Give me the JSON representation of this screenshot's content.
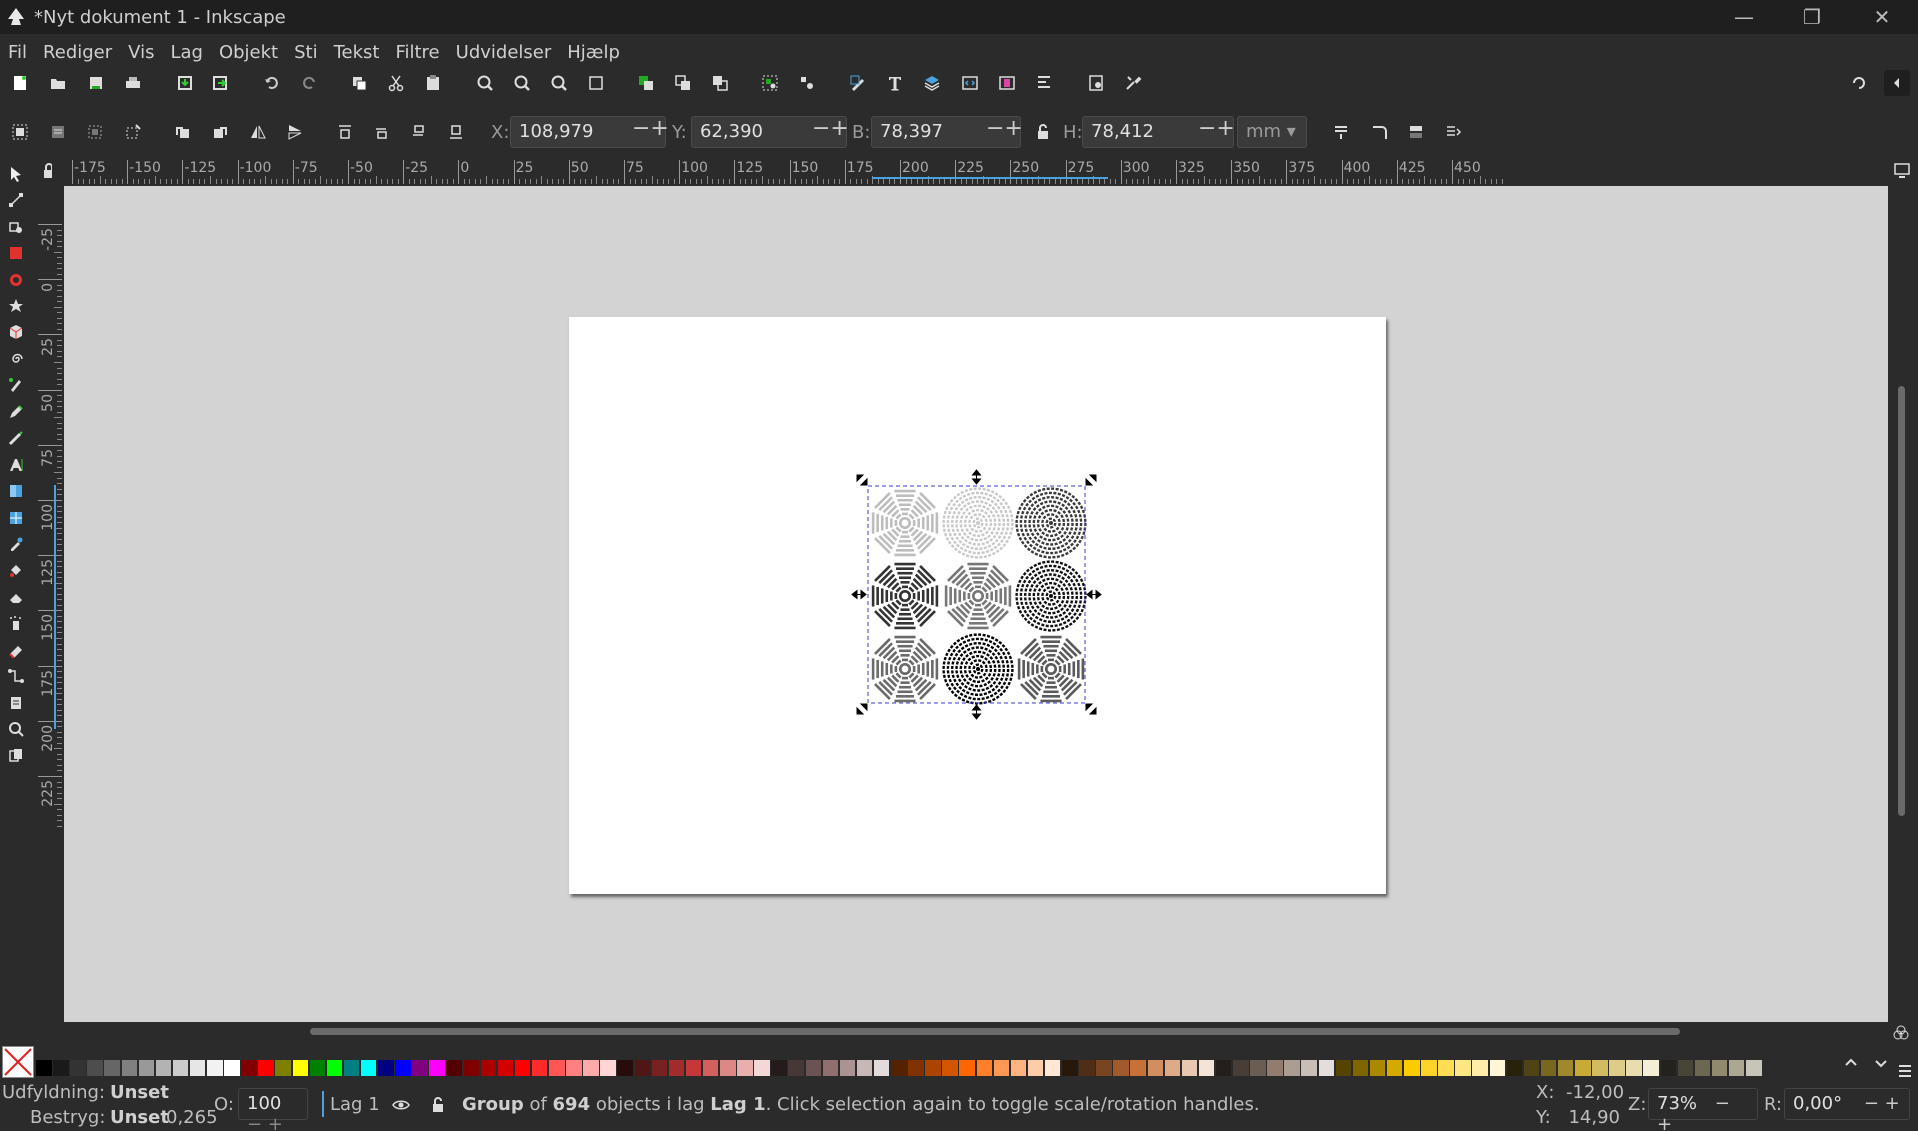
{
  "window": {
    "title": "*Nyt dokument 1 - Inkscape"
  },
  "menu": [
    "Fil",
    "Rediger",
    "Vis",
    "Lag",
    "Objekt",
    "Sti",
    "Tekst",
    "Filtre",
    "Udvidelser",
    "Hjælp"
  ],
  "toolbar_icons": [
    "new-document-icon",
    "open-icon",
    "save-icon",
    "print-icon",
    "import-icon",
    "export-icon",
    "undo-icon",
    "redo-icon",
    "copy-icon",
    "cut-icon",
    "paste-icon",
    "zoom-selection-icon",
    "zoom-drawing-icon",
    "zoom-page-icon",
    "zoom-width-icon",
    "duplicate-icon",
    "clone-icon",
    "unlink-clone-icon",
    "group-icon",
    "ungroup-icon",
    "fill-stroke-icon",
    "text-font-icon",
    "layers-icon",
    "xml-editor-icon",
    "objects-icon",
    "align-icon",
    "document-properties-icon",
    "preferences-icon"
  ],
  "controls": {
    "x_label": "X:",
    "x_value": "108,979",
    "y_label": "Y:",
    "y_value": "62,390",
    "w_label": "B:",
    "w_value": "78,397",
    "h_label": "H:",
    "h_value": "78,412",
    "unit": "mm"
  },
  "rulers": {
    "h_ticks": [
      "-175",
      "-150",
      "-125",
      "-100",
      "-75",
      "-50",
      "-25",
      "0",
      "25",
      "50",
      "75",
      "100",
      "125",
      "150",
      "175",
      "200",
      "225",
      "250",
      "275",
      "300",
      "325",
      "350",
      "375",
      "400",
      "425",
      "450"
    ],
    "v_ticks": [
      "-25",
      "0",
      "25",
      "50",
      "75",
      "100",
      "125",
      "150",
      "175",
      "200",
      "225"
    ]
  },
  "tools": [
    "selector-tool-icon",
    "node-tool-icon",
    "tweak-tool-icon",
    "rectangle-tool-icon",
    "ellipse-tool-icon",
    "star-tool-icon",
    "box3d-tool-icon",
    "spiral-tool-icon",
    "pen-tool-icon",
    "pencil-tool-icon",
    "calligraphy-tool-icon",
    "text-tool-icon",
    "gradient-tool-icon",
    "mesh-tool-icon",
    "dropper-tool-icon",
    "paint-bucket-tool-icon",
    "eraser-tool-icon",
    "spray-tool-icon",
    "measure-eraser-icon",
    "connector-tool-icon",
    "pages-tool-icon",
    "zoom-tool-icon",
    "pages-2-icon"
  ],
  "colors": {
    "accent": "#4aa3df",
    "selection": "#3a3ad0"
  },
  "palette": [
    "#000000",
    "#1a1a1a",
    "#333333",
    "#4d4d4d",
    "#666666",
    "#808080",
    "#999999",
    "#b3b3b3",
    "#cccccc",
    "#e6e6e6",
    "#f2f2f2",
    "#ffffff",
    "#800000",
    "#ff0000",
    "#808000",
    "#ffff00",
    "#008000",
    "#00ff00",
    "#008080",
    "#00ffff",
    "#000080",
    "#0000ff",
    "#800080",
    "#ff00ff",
    "#550000",
    "#800000",
    "#aa0000",
    "#d40000",
    "#ff0000",
    "#ff2a2a",
    "#ff5555",
    "#ff8080",
    "#ffaaaa",
    "#ffd5d5",
    "#280b0b",
    "#501616",
    "#782121",
    "#a02c2c",
    "#c83737",
    "#d35f5f",
    "#de8787",
    "#e9afaf",
    "#f4d7d7",
    "#241c1c",
    "#483737",
    "#6c5353",
    "#916f6f",
    "#ac9393",
    "#c8b7b7",
    "#e3dbdb",
    "#552200",
    "#803300",
    "#aa4400",
    "#d45500",
    "#ff6600",
    "#ff7f2a",
    "#ff9955",
    "#ffb380",
    "#ffccaa",
    "#ffe6d5",
    "#28170b",
    "#502d16",
    "#784421",
    "#a05a2c",
    "#c87137",
    "#d38d5f",
    "#deaa87",
    "#e9c6af",
    "#f4e3d7",
    "#241f1c",
    "#483e37",
    "#6c5d53",
    "#917c6f",
    "#ac9d93",
    "#c8beb7",
    "#e3dedb",
    "#554400",
    "#806600",
    "#aa8800",
    "#d4aa00",
    "#ffcc00",
    "#ffd42a",
    "#ffdd55",
    "#ffe680",
    "#ffeeaa",
    "#fff6d5",
    "#28220b",
    "#504416",
    "#786721",
    "#a0892c",
    "#c8ab37",
    "#d3bc5f",
    "#decd87",
    "#e9ddaf",
    "#f4eed7",
    "#24221c",
    "#484537",
    "#6c6753",
    "#918a6f",
    "#aca793",
    "#c8c4b7"
  ],
  "status": {
    "fill_label": "Udfyldning:",
    "fill_value": "Unset",
    "stroke_label": "Bestryg:",
    "stroke_value": "Unset",
    "stroke_width": "0,265",
    "opacity_label": "O:",
    "opacity_value": "100",
    "layer": "Lag 1",
    "msg_a": "Group",
    "msg_b": " of ",
    "msg_count": "694",
    "msg_c": " objects i lag ",
    "msg_layer": "Lag 1",
    "msg_d": ". Click selection again to toggle scale/rotation handles.",
    "cx_label": "X:",
    "cx_value": "-12,00",
    "cy_label": "Y:",
    "cy_value": "14,90",
    "zoom_label": "Z:",
    "zoom_value": "73%",
    "rot_label": "R:",
    "rot_value": "0,00°"
  }
}
